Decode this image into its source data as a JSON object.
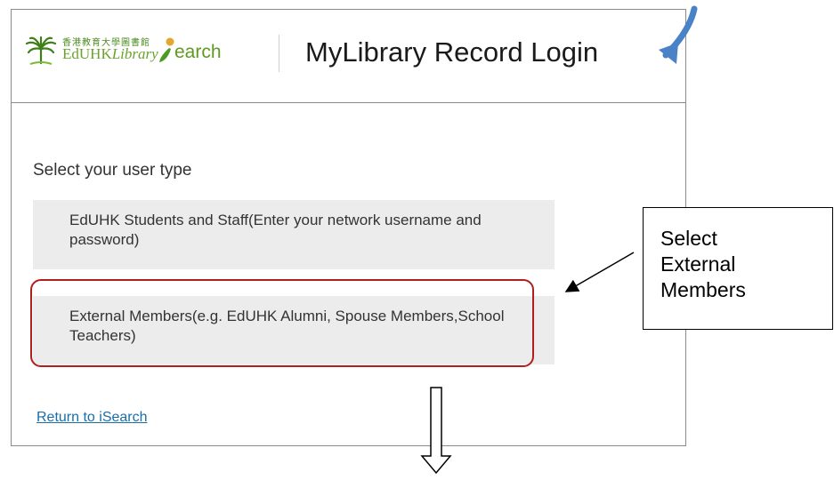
{
  "header": {
    "logo_chinese": "香港教育大學圖書館",
    "logo_brand": "EdUHK",
    "logo_library": "Library",
    "logo_isearch": "earch",
    "title": "MyLibrary Record Login"
  },
  "main": {
    "subtitle": "Select your user type",
    "options": [
      {
        "label": "EdUHK Students and Staff(Enter your network username and password)"
      },
      {
        "label": "External Members(e.g. EdUHK Alumni, Spouse Members,School Teachers)"
      }
    ],
    "return_link": "Return to iSearch"
  },
  "annotation": {
    "callout_lines": [
      "Select",
      "External",
      "Members"
    ],
    "highlight_color": "#b01e1e",
    "top_arrow_color": "#4a82c8"
  },
  "colors": {
    "brand_green": "#6aa22c",
    "link_blue": "#1a6ea8",
    "option_bg": "#ececec"
  }
}
